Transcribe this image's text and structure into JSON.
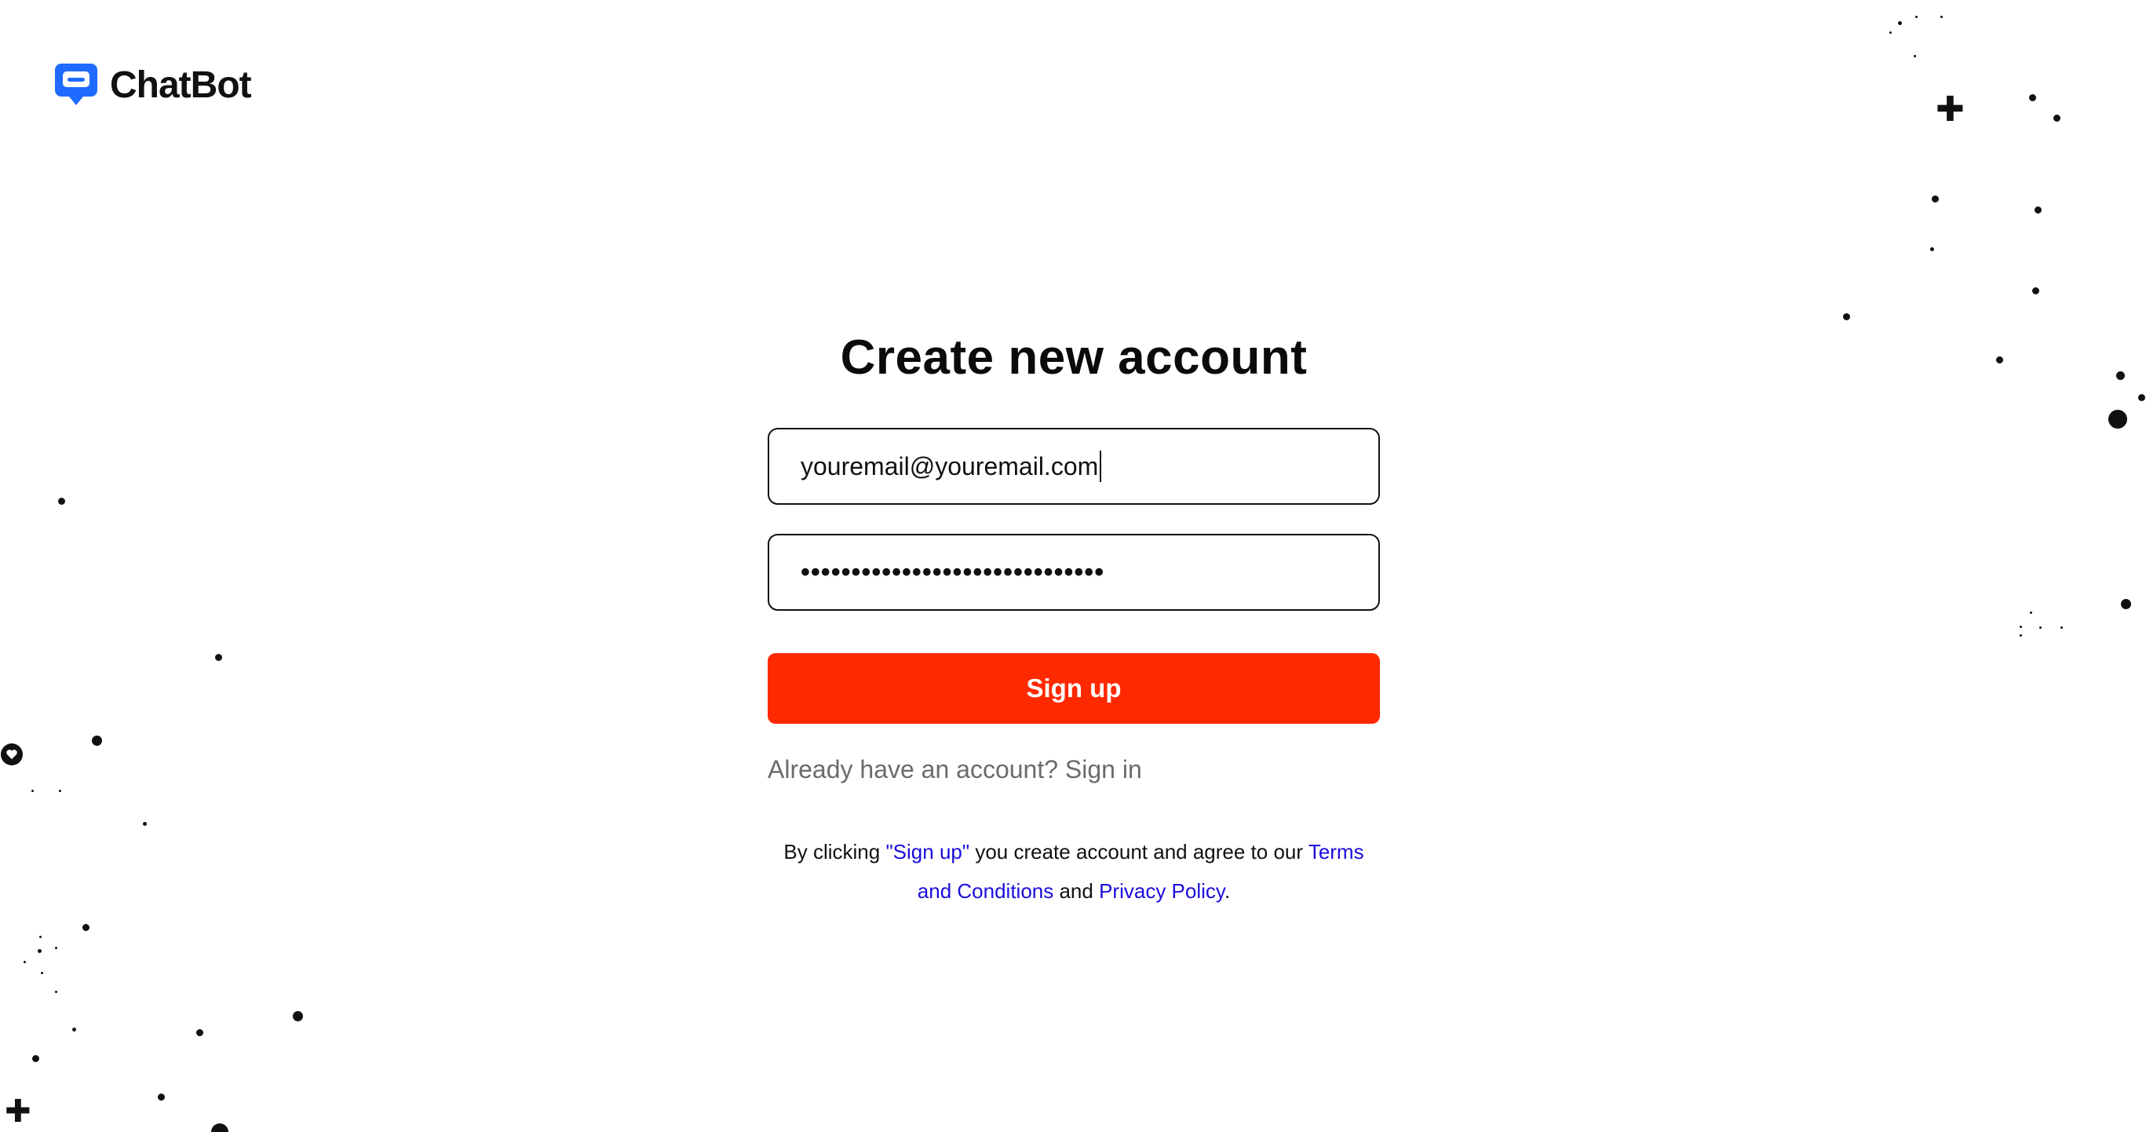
{
  "logo": {
    "icon": "chatbot-logo-icon",
    "text": "ChatBot",
    "color": "#1f6bff"
  },
  "form": {
    "title": "Create new account",
    "email_value": "youremail@youremail.com",
    "password_value": "••••••••••••••••••••••••••••••",
    "signup_label": "Sign up",
    "signin_text": "Already have an account? Sign in"
  },
  "terms": {
    "prefix": "By clicking ",
    "signup_quote": "\"Sign up\"",
    "middle": " you create account and agree to our ",
    "terms_link": "Terms and Conditions",
    "and": " and ",
    "privacy_link": "Privacy Policy",
    "suffix": "."
  },
  "colors": {
    "accent": "#ff2900",
    "link": "#1a0ddb",
    "text": "#111111",
    "muted": "#6b6b6b"
  }
}
